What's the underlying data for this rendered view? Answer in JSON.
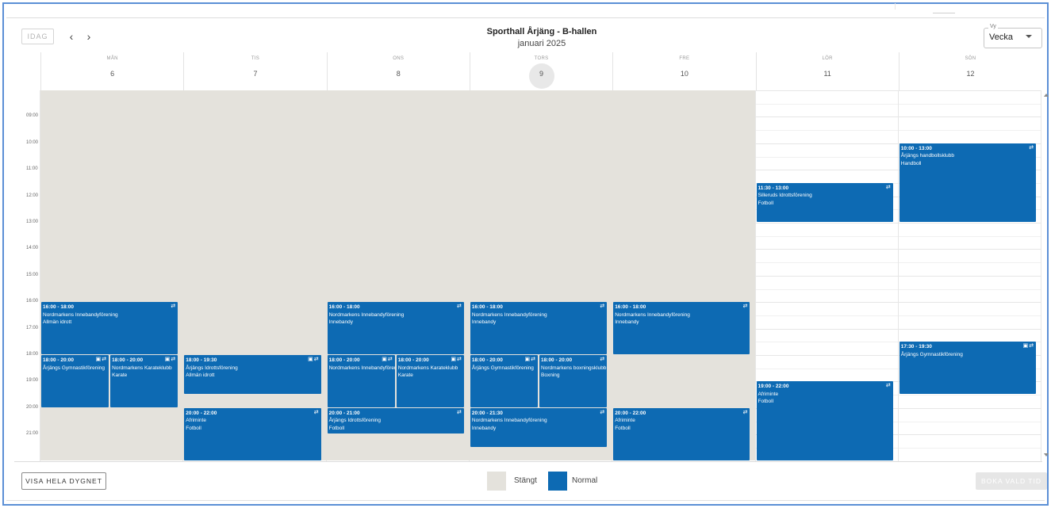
{
  "header": {
    "today_label": "IDAG",
    "prev_icon": "chevron-left-icon",
    "next_icon": "chevron-right-icon",
    "title": "Sporthall Årjäng - B-hallen",
    "subtitle": "januari 2025",
    "view_label": "Vy",
    "view_value": "Vecka"
  },
  "days": [
    {
      "dow": "MÅN",
      "dom": "6"
    },
    {
      "dow": "TIS",
      "dom": "7"
    },
    {
      "dow": "ONS",
      "dom": "8"
    },
    {
      "dow": "TORS",
      "dom": "9",
      "today": true
    },
    {
      "dow": "FRE",
      "dom": "10"
    },
    {
      "dow": "LÖR",
      "dom": "11"
    },
    {
      "dow": "SÖN",
      "dom": "12"
    }
  ],
  "hours": [
    "09:00",
    "10:00",
    "11:00",
    "12:00",
    "13:00",
    "14:00",
    "15:00",
    "16:00",
    "17:00",
    "18:00",
    "19:00",
    "20:00",
    "21:00"
  ],
  "closed_period": {
    "days": [
      "MÅN",
      "TIS",
      "ONS",
      "TORS",
      "FRE"
    ],
    "start": "08:00",
    "end": "16:00"
  },
  "events": [
    {
      "day": 0,
      "start": "16:00",
      "end": "18:00",
      "time": "16:00 - 18:00",
      "org": "Nordmarkens Innebandyförening",
      "activity": "Allmän idrott",
      "col": 0,
      "cols": 1,
      "lock": false
    },
    {
      "day": 0,
      "start": "18:00",
      "end": "20:00",
      "time": "18:00 - 20:00",
      "org": "Årjängs Gymnastikförening",
      "activity": "",
      "col": 0,
      "cols": 2,
      "lock": true
    },
    {
      "day": 0,
      "start": "18:00",
      "end": "20:00",
      "time": "18:00 - 20:00",
      "org": "Nordmarkens Karateklubb",
      "activity": "Karate",
      "col": 1,
      "cols": 2,
      "lock": true
    },
    {
      "day": 1,
      "start": "18:00",
      "end": "19:30",
      "time": "18:00 - 19:30",
      "org": "Årjängs Idrottsförening",
      "activity": "Allmän idrott",
      "col": 0,
      "cols": 1,
      "lock": true
    },
    {
      "day": 1,
      "start": "20:00",
      "end": "22:00",
      "time": "20:00 - 22:00",
      "org": "Afriminte",
      "activity": "Fotboll",
      "col": 0,
      "cols": 1,
      "lock": false
    },
    {
      "day": 2,
      "start": "16:00",
      "end": "18:00",
      "time": "16:00 - 18:00",
      "org": "Nordmarkens Innebandyförening",
      "activity": "Innebandy",
      "col": 0,
      "cols": 1,
      "lock": false
    },
    {
      "day": 2,
      "start": "18:00",
      "end": "20:00",
      "time": "18:00 - 20:00",
      "org": "Nordmarkens Innebandyförening",
      "activity": "",
      "col": 0,
      "cols": 2,
      "lock": true
    },
    {
      "day": 2,
      "start": "18:00",
      "end": "20:00",
      "time": "18:00 - 20:00",
      "org": "Nordmarkens Karateklubb",
      "activity": "Karate",
      "col": 1,
      "cols": 2,
      "lock": true
    },
    {
      "day": 2,
      "start": "20:00",
      "end": "21:00",
      "time": "20:00 - 21:00",
      "org": "Årjängs Idrottsförening",
      "activity": "Fotboll",
      "col": 0,
      "cols": 1,
      "lock": false
    },
    {
      "day": 3,
      "start": "16:00",
      "end": "18:00",
      "time": "16:00 - 18:00",
      "org": "Nordmarkens Innebandyförening",
      "activity": "Innebandy",
      "col": 0,
      "cols": 1,
      "lock": false
    },
    {
      "day": 3,
      "start": "18:00",
      "end": "20:00",
      "time": "18:00 - 20:00",
      "org": "Årjängs Gymnastikförening",
      "activity": "",
      "col": 0,
      "cols": 2,
      "lock": true
    },
    {
      "day": 3,
      "start": "18:00",
      "end": "20:00",
      "time": "18:00 - 20:00",
      "org": "Nordmarkens boxningsklubb",
      "activity": "Boxning",
      "col": 1,
      "cols": 2,
      "lock": false
    },
    {
      "day": 3,
      "start": "20:00",
      "end": "21:30",
      "time": "20:00 - 21:30",
      "org": "Nordmarkens Innebandyförening",
      "activity": "Innebandy",
      "col": 0,
      "cols": 1,
      "lock": false
    },
    {
      "day": 4,
      "start": "16:00",
      "end": "18:00",
      "time": "16:00 - 18:00",
      "org": "Nordmarkens Innebandyförening",
      "activity": "Innebandy",
      "col": 0,
      "cols": 1,
      "lock": false
    },
    {
      "day": 4,
      "start": "20:00",
      "end": "22:00",
      "time": "20:00 - 22:00",
      "org": "Afriminte",
      "activity": "Fotboll",
      "col": 0,
      "cols": 1,
      "lock": false
    },
    {
      "day": 5,
      "start": "11:30",
      "end": "13:00",
      "time": "11:30 - 13:00",
      "org": "Silleruds Idrottsförening",
      "activity": "Fotboll",
      "col": 0,
      "cols": 1,
      "lock": false
    },
    {
      "day": 5,
      "start": "19:00",
      "end": "22:00",
      "time": "19:00 - 22:00",
      "org": "Afriminte",
      "activity": "Fotboll",
      "col": 0,
      "cols": 1,
      "lock": false
    },
    {
      "day": 6,
      "start": "10:00",
      "end": "13:00",
      "time": "10:00 - 13:00",
      "org": "Årjängs handbollsklubb",
      "activity": "Handboll",
      "col": 0,
      "cols": 1,
      "lock": false
    },
    {
      "day": 6,
      "start": "17:30",
      "end": "19:30",
      "time": "17:30 - 19:30",
      "org": "Årjängs Gymnastikförening",
      "activity": "",
      "col": 0,
      "cols": 1,
      "lock": true
    }
  ],
  "footer": {
    "show_all_day_label": "VISA HELA DYGNET",
    "legend": [
      {
        "label": "Stängt",
        "color": "#e4e2dc"
      },
      {
        "label": "Normal",
        "color": "#0d6ab3"
      }
    ],
    "book_label": "BOKA VALD TID"
  },
  "colors": {
    "event": "#0d6ab3",
    "closed": "#e4e2dc",
    "frame": "#5b8fd6"
  },
  "icons": {
    "repeat": "repeat-icon",
    "lock": "lock-icon"
  }
}
